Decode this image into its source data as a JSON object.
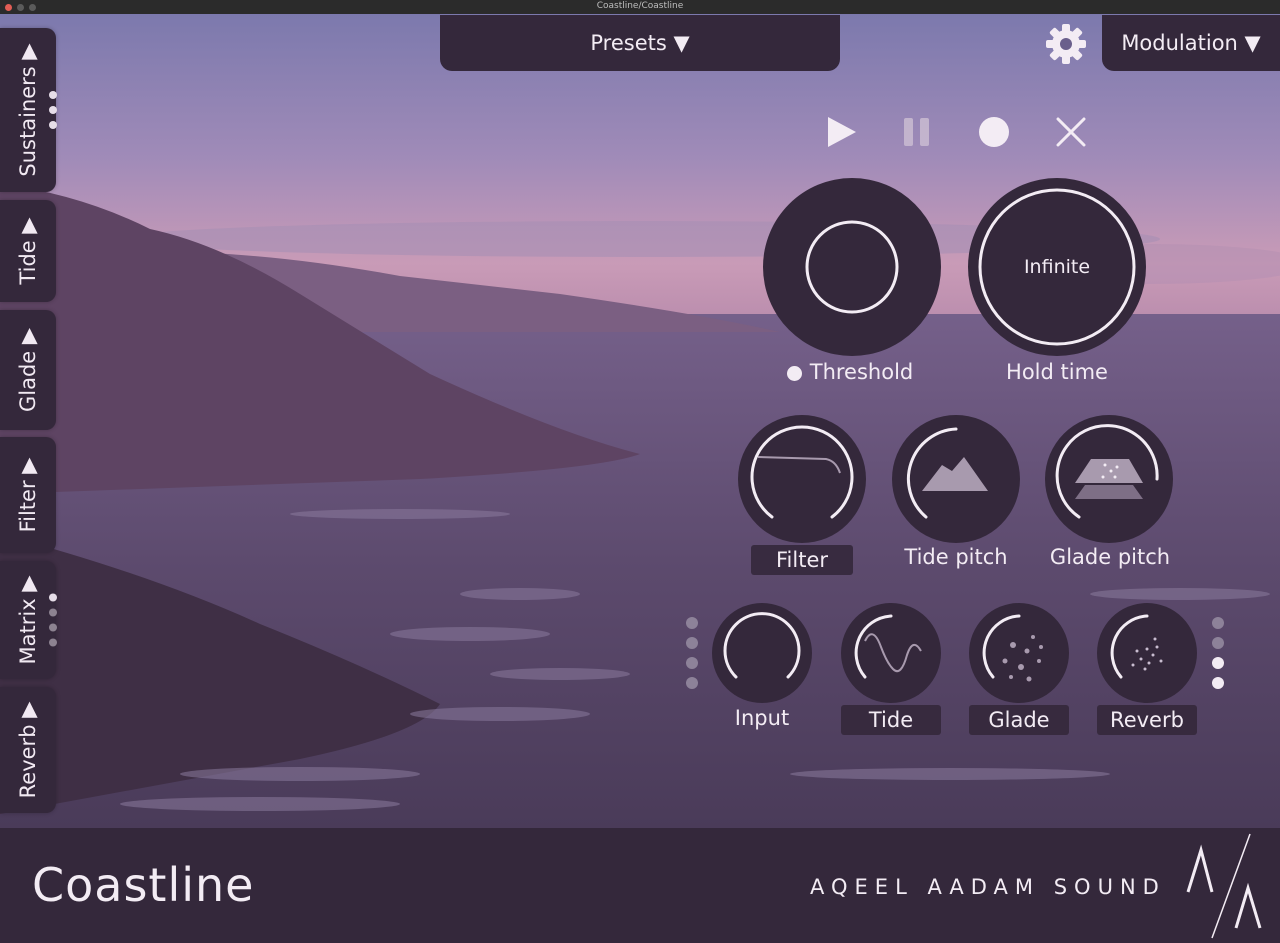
{
  "window": {
    "title": "Coastline/Coastline"
  },
  "sidebar": {
    "tabs": [
      {
        "label": "Sustainers ▶"
      },
      {
        "label": "Tide ▶"
      },
      {
        "label": "Glade ▶"
      },
      {
        "label": "Filter ▶"
      },
      {
        "label": "Matrix ▶"
      },
      {
        "label": "Reverb ▶"
      }
    ]
  },
  "header": {
    "presets_label": "Presets ▼",
    "modulation_label": "Modulation ▼",
    "settings_icon": "gear-icon"
  },
  "transport": {
    "icons": [
      "play-icon",
      "pause-icon",
      "record-icon",
      "clear-icon"
    ]
  },
  "main_knobs": {
    "threshold": {
      "label": "Threshold",
      "indicator": "on"
    },
    "hold_time": {
      "label": "Hold time",
      "value": "Infinite"
    }
  },
  "mid_knobs": {
    "filter": {
      "label": "Filter"
    },
    "tide_pitch": {
      "label": "Tide pitch"
    },
    "glade_pitch": {
      "label": "Glade pitch"
    }
  },
  "bottom_knobs": {
    "input": {
      "label": "Input"
    },
    "tide": {
      "label": "Tide"
    },
    "glade": {
      "label": "Glade"
    },
    "reverb": {
      "label": "Reverb"
    }
  },
  "footer": {
    "product": "Coastline",
    "company": "AQEEL AADAM SOUND",
    "logo_text": "/\\ /\\"
  },
  "colors": {
    "panel": "#34283b",
    "text": "#f3ecf4",
    "sky_top": "#7b78ad",
    "sky_horizon": "#c79ab8",
    "water": "#5a4869"
  }
}
